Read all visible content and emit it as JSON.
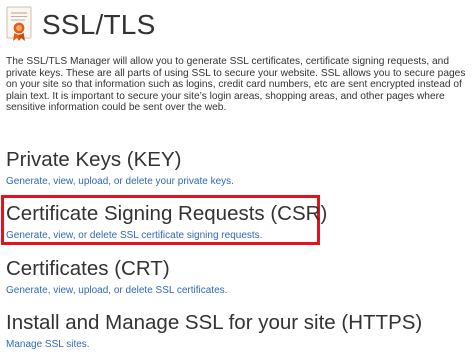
{
  "header": {
    "title": "SSL/TLS",
    "icon": "certificate-icon",
    "accent_color": "#e65c17"
  },
  "intro": {
    "text": "The SSL/TLS Manager will allow you to generate SSL certificates, certificate signing requests, and private keys. These are all parts of using SSL to secure your website. SSL allows you to secure pages on your site so that information such as logins, credit card numbers, etc are sent encrypted instead of plain text. It is important to secure your site’s login areas, shopping areas, and other pages where sensitive information could be sent over the web."
  },
  "sections": [
    {
      "title": "Private Keys (KEY)",
      "link": "Generate, view, upload, or delete your private keys."
    },
    {
      "title": "Certificate Signing Requests (CSR)",
      "link": "Generate, view, or delete SSL certificate signing requests."
    },
    {
      "title": "Certificates (CRT)",
      "link": "Generate, view, upload, or delete SSL certificates."
    },
    {
      "title": "Install and Manage SSL for your site (HTTPS)",
      "link": "Manage SSL sites."
    }
  ],
  "colors": {
    "link": "#2e6ab7",
    "highlight_border": "#e3121f"
  }
}
